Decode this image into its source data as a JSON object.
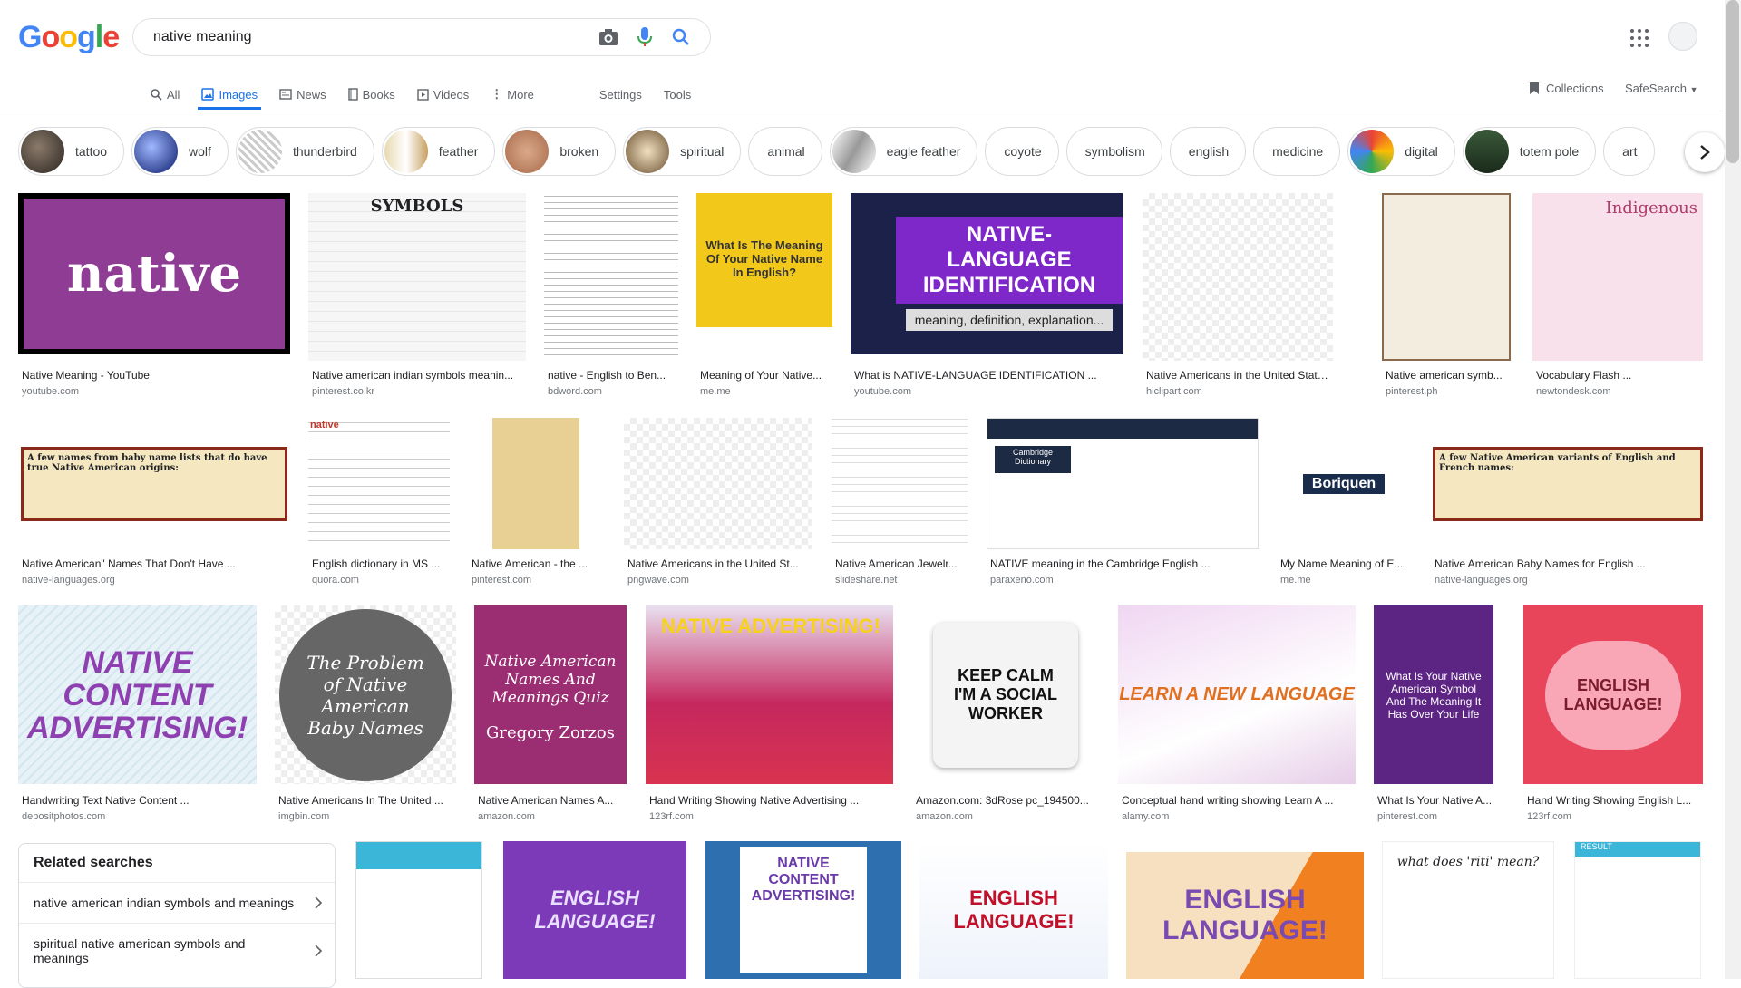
{
  "logo": "Google",
  "search": {
    "query": "native meaning"
  },
  "tabs": [
    {
      "label": "All"
    },
    {
      "label": "Images"
    },
    {
      "label": "News"
    },
    {
      "label": "Books"
    },
    {
      "label": "Videos"
    },
    {
      "label": "More"
    }
  ],
  "tools": {
    "settings": "Settings",
    "tools": "Tools"
  },
  "collections": "Collections",
  "safesearch": "SafeSearch",
  "chips": [
    {
      "label": "tattoo"
    },
    {
      "label": "wolf"
    },
    {
      "label": "thunderbird"
    },
    {
      "label": "feather"
    },
    {
      "label": "broken"
    },
    {
      "label": "spiritual"
    },
    {
      "label": "animal"
    },
    {
      "label": "eagle feather"
    },
    {
      "label": "coyote"
    },
    {
      "label": "symbolism"
    },
    {
      "label": "english"
    },
    {
      "label": "medicine"
    },
    {
      "label": "digital"
    },
    {
      "label": "totem pole"
    },
    {
      "label": "art"
    }
  ],
  "row1": [
    {
      "title": "Native Meaning - YouTube",
      "source": "youtube.com",
      "img_text": "native"
    },
    {
      "title": "Native american indian symbols meanin...",
      "source": "pinterest.co.kr",
      "img_text": "SYMBOLS"
    },
    {
      "title": "native - English to Ben...",
      "source": "bdword.com",
      "img_text": ""
    },
    {
      "title": "Meaning of Your Native...",
      "source": "me.me",
      "img_text": "What Is The Meaning Of Your Native Name In English?"
    },
    {
      "title": "What is NATIVE-LANGUAGE IDENTIFICATION ...",
      "source": "youtube.com",
      "img_text": "NATIVE-LANGUAGE IDENTIFICATION",
      "img_sub": "meaning, definition, explanation..."
    },
    {
      "title": "Native Americans in the United States ...",
      "source": "hiclipart.com",
      "img_text": ""
    },
    {
      "title": "Native american symb...",
      "source": "pinterest.ph",
      "img_text": ""
    },
    {
      "title": "Vocabulary Flash ...",
      "source": "newtondesk.com",
      "img_text": "Indigenous"
    }
  ],
  "row2": [
    {
      "title": "Native American\" Names That Don't Have ...",
      "source": "native-languages.org",
      "img_text": "A few names from baby name lists that do have true Native American origins:"
    },
    {
      "title": "English dictionary in MS ...",
      "source": "quora.com",
      "img_text": "native"
    },
    {
      "title": "Native American - the ...",
      "source": "pinterest.com",
      "img_text": ""
    },
    {
      "title": "Native Americans in the United St...",
      "source": "pngwave.com",
      "img_text": ""
    },
    {
      "title": "Native American Jewelr...",
      "source": "slideshare.net",
      "img_text": ""
    },
    {
      "title": "NATIVE meaning in the Cambridge English ...",
      "source": "paraxeno.com",
      "img_text": "Cambridge Dictionary"
    },
    {
      "title": "My Name Meaning of E...",
      "source": "me.me",
      "img_text": "Boriquen"
    },
    {
      "title": "Native American Baby Names for English ...",
      "source": "native-languages.org",
      "img_text": "A few Native American variants of English and French names:"
    }
  ],
  "row3": [
    {
      "title": "Handwriting Text Native Content ...",
      "source": "depositphotos.com",
      "img_text": "NATIVE CONTENT ADVERTISING!"
    },
    {
      "title": "Native Americans In The United ...",
      "source": "imgbin.com",
      "img_text": "The Problem of Native American Baby Names"
    },
    {
      "title": "Native American Names A...",
      "source": "amazon.com",
      "img_text": "Native American Names And Meanings Quiz",
      "img_sub": "Gregory Zorzos"
    },
    {
      "title": "Hand Writing Showing Native Advertising ...",
      "source": "123rf.com",
      "img_text": "NATIVE ADVERTISING!"
    },
    {
      "title": "Amazon.com: 3dRose pc_194500...",
      "source": "amazon.com",
      "img_text": "KEEP CALM I'M A SOCIAL WORKER"
    },
    {
      "title": "Conceptual hand writing showing Learn A ...",
      "source": "alamy.com",
      "img_text": "LEARN A NEW LANGUAGE"
    },
    {
      "title": "What Is Your Native A...",
      "source": "pinterest.com",
      "img_text": "What Is Your Native American Symbol And The Meaning It Has Over Your Life"
    },
    {
      "title": "Hand Writing Showing English L...",
      "source": "123rf.com",
      "img_text": "ENGLISH LANGUAGE!"
    }
  ],
  "row4": [
    {
      "img_text": ""
    },
    {
      "img_text": "ENGLISH LANGUAGE!"
    },
    {
      "img_text": "NATIVE CONTENT ADVERTISING!"
    },
    {
      "img_text": "ENGLISH LANGUAGE!"
    },
    {
      "img_text": "ENGLISH LANGUAGE!"
    },
    {
      "img_text": "what does 'riti' mean?"
    },
    {
      "img_text": "RESULT"
    }
  ],
  "related": {
    "heading": "Related searches",
    "items": [
      {
        "label": "native american indian symbols and meanings"
      },
      {
        "label": "spiritual native american symbols and meanings"
      }
    ]
  },
  "colors": {
    "accent": "#1a73e8",
    "text": "#202124",
    "muted": "#70757a"
  }
}
